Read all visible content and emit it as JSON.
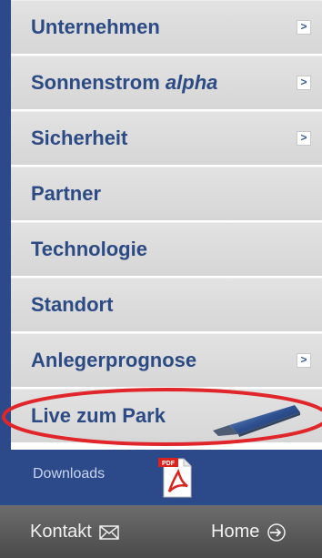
{
  "menu": {
    "items": [
      {
        "label": "Unternehmen",
        "label_italic": "",
        "has_arrow": true
      },
      {
        "label": "Sonnenstrom",
        "label_italic": "alpha",
        "has_arrow": true
      },
      {
        "label": "Sicherheit",
        "label_italic": "",
        "has_arrow": true
      },
      {
        "label": "Partner",
        "label_italic": "",
        "has_arrow": false
      },
      {
        "label": "Technologie",
        "label_italic": "",
        "has_arrow": false
      },
      {
        "label": "Standort",
        "label_italic": "",
        "has_arrow": false
      },
      {
        "label": "Anlegerprognose",
        "label_italic": "",
        "has_arrow": true
      },
      {
        "label": "Live zum Park",
        "label_italic": "",
        "has_arrow": false
      }
    ],
    "arrow_glyph": ">"
  },
  "downloads": {
    "label": "Downloads",
    "pdf_badge": "PDF"
  },
  "footer": {
    "kontakt_label": "Kontakt",
    "home_label": "Home"
  },
  "colors": {
    "brand_blue": "#2c4a8a",
    "highlight_red": "#e0262a"
  }
}
